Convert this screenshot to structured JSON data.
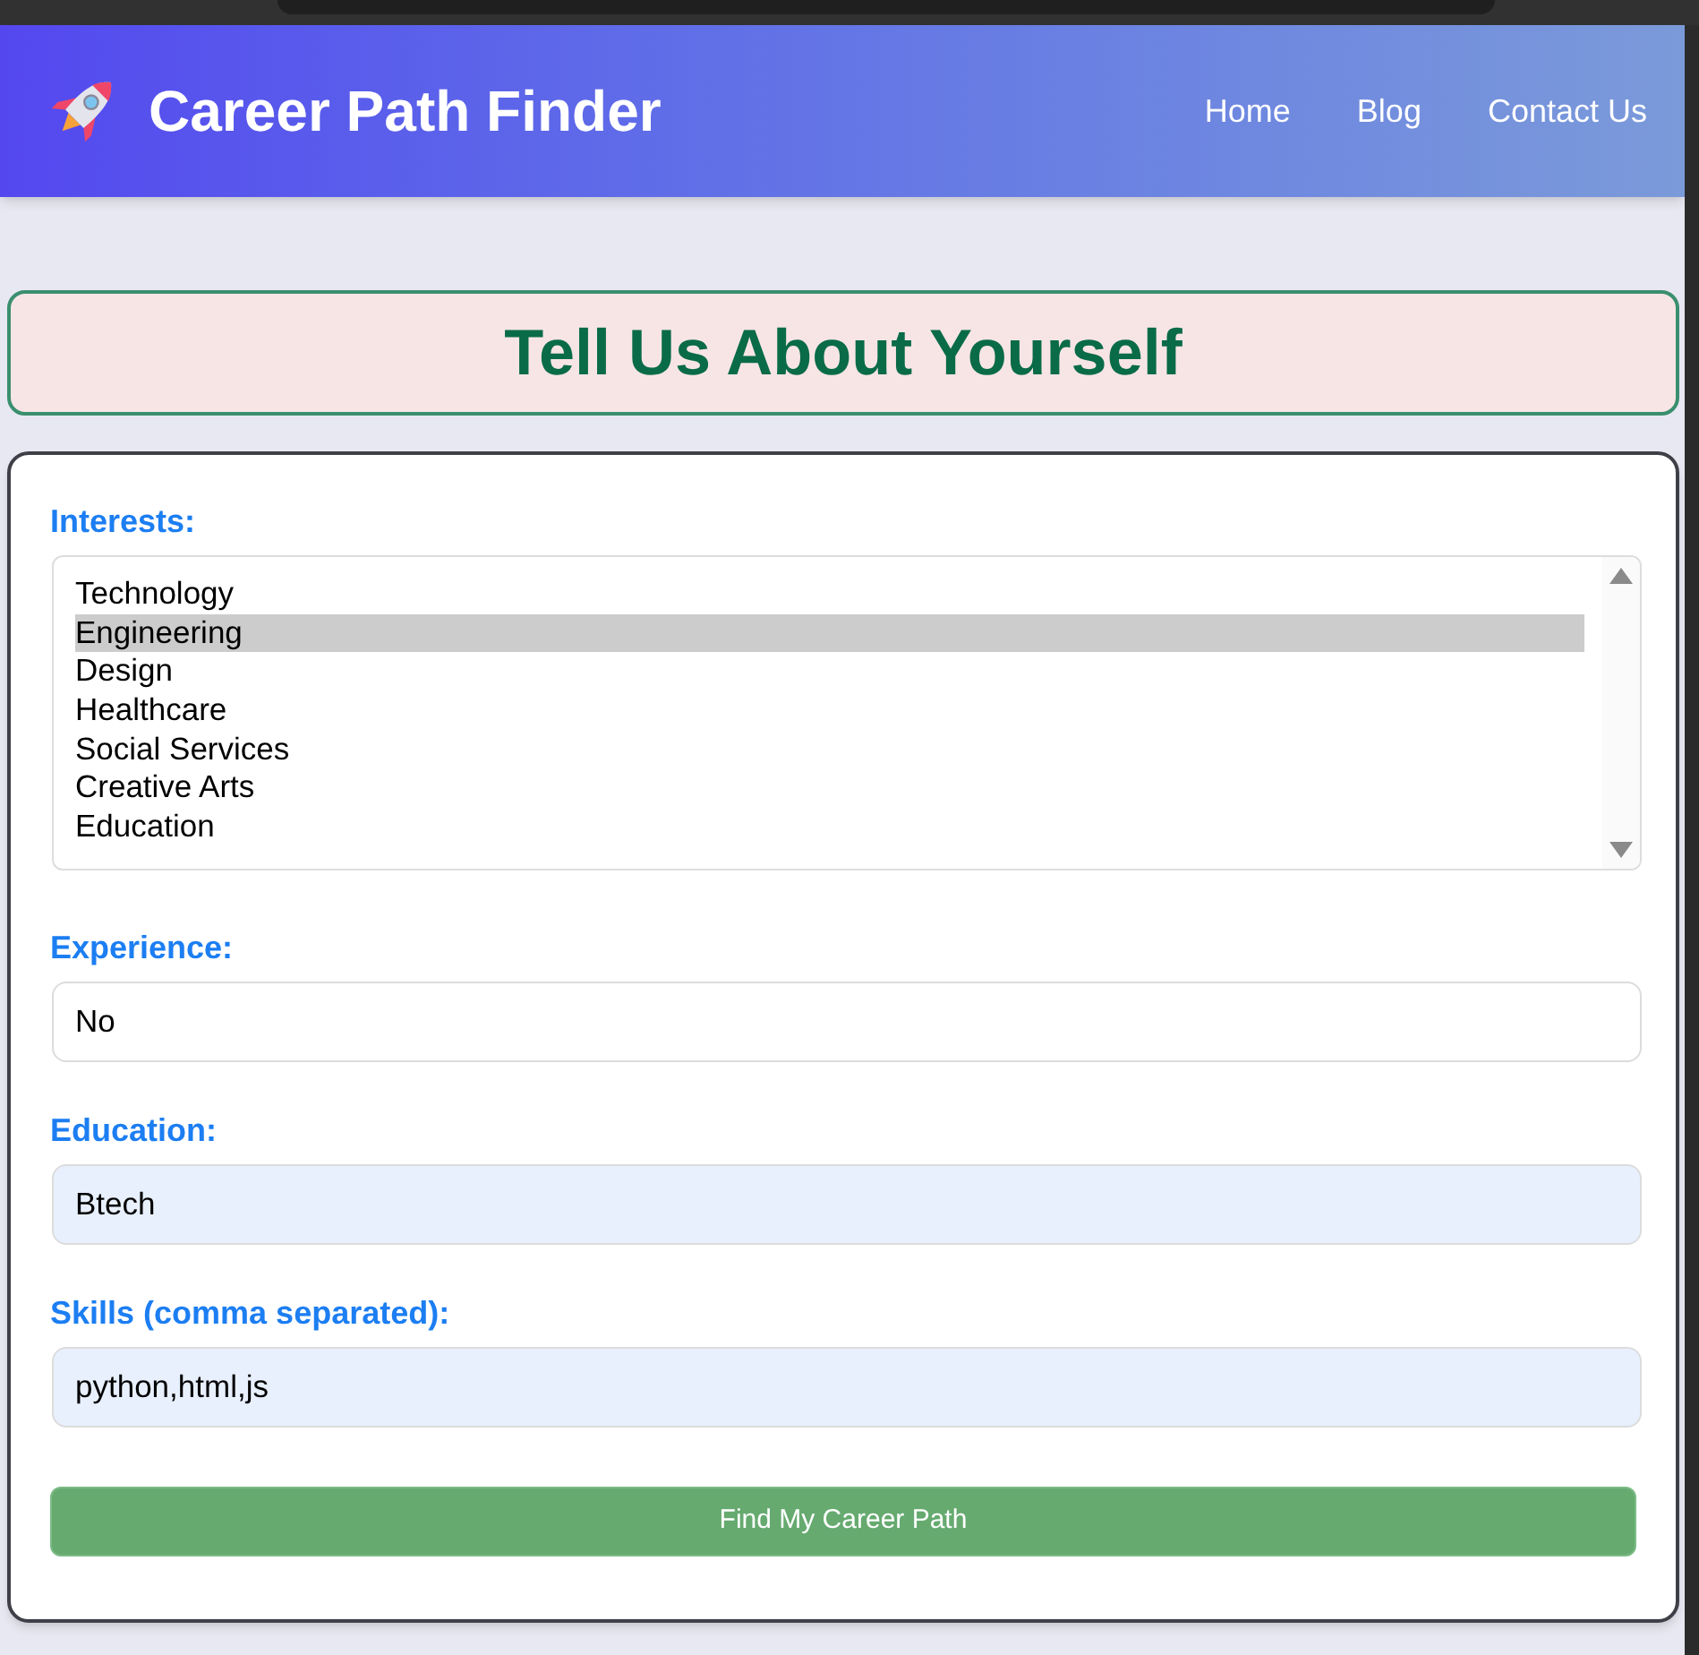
{
  "header": {
    "title": "Career Path Finder",
    "nav": [
      "Home",
      "Blog",
      "Contact Us"
    ]
  },
  "form_heading": "Tell Us About Yourself",
  "form": {
    "interests": {
      "label": "Interests:",
      "options": [
        {
          "label": "Technology",
          "selected": false
        },
        {
          "label": "Engineering",
          "selected": true
        },
        {
          "label": "Design",
          "selected": false
        },
        {
          "label": "Healthcare",
          "selected": false
        },
        {
          "label": "Social Services",
          "selected": false
        },
        {
          "label": "Creative Arts",
          "selected": false
        },
        {
          "label": "Education",
          "selected": false
        }
      ]
    },
    "fields": [
      {
        "label": "Experience:",
        "value": "No",
        "autofilled": false
      },
      {
        "label": "Education:",
        "value": "Btech",
        "autofilled": true
      },
      {
        "label": "Skills (comma separated):",
        "value": "python,html,js",
        "autofilled": true
      }
    ],
    "submit": "Find My Career Path"
  }
}
